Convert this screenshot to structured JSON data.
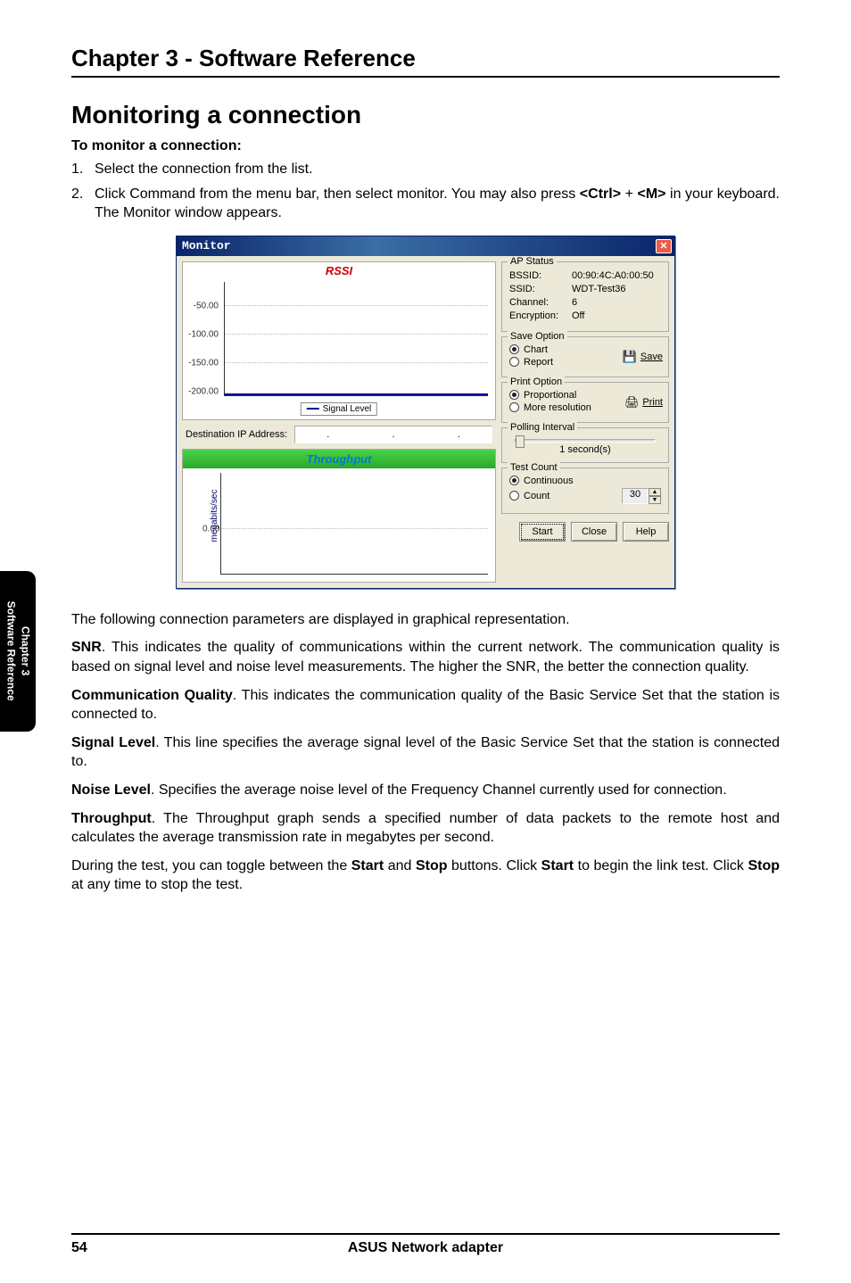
{
  "chapter_title": "Chapter 3 - Software Reference",
  "section_title": "Monitoring a connection",
  "sub_heading": "To monitor a connection:",
  "steps": [
    {
      "num": "1.",
      "text": "Select the connection from the list."
    },
    {
      "num": "2.",
      "text_before": "Click Command from the menu bar, then select monitor. You may also press ",
      "key1": "<Ctrl>",
      "plus": " + ",
      "key2": "<M>",
      "text_after": " in your keyboard. The Monitor window appears."
    }
  ],
  "body": {
    "p1": "The following connection parameters are displayed in graphical representation.",
    "snr_label": "SNR",
    "snr_text": ". This indicates the quality of communications within the current network. The communication quality is based on signal level and noise level measurements. The higher the SNR, the better the connection quality.",
    "cq_label": "Communication Quality",
    "cq_text": ". This indicates the communication quality of the Basic Service Set that the station is connected to.",
    "sl_label": "Signal Level",
    "sl_text": ". This line specifies the average signal level of the Basic Service Set that the station is connected to.",
    "nl_label": "Noise Level",
    "nl_text": ". Specifies the average noise level of the Frequency Channel currently used for connection.",
    "tp_label": "Throughput",
    "tp_text": ". The Throughput graph sends a specified number of data packets to the remote host and calculates the average transmission rate in megabytes per second.",
    "last_before": "During the test, you can toggle between the ",
    "start": "Start",
    "and": " and ",
    "stop": "Stop",
    "mid": " buttons. Click ",
    "start2": "Start",
    "mid2": " to begin the link test. Click ",
    "stop2": "Stop",
    "end": " at any time to stop the test."
  },
  "side_tab": {
    "line1": "Chapter 3",
    "line2": "Software Reference"
  },
  "footer": {
    "page": "54",
    "title": "ASUS Network adapter"
  },
  "dialog": {
    "title": "Monitor",
    "close_glyph": "✕",
    "rssi": {
      "title": "RSSI",
      "yticks": [
        "-50.00",
        "-100.00",
        "-150.00",
        "-200.00"
      ],
      "legend": "Signal Level"
    },
    "dest_label": "Destination IP Address:",
    "throughput": {
      "title": "Throughput",
      "ylabel": "megabits/sec",
      "ytick": "0.00"
    },
    "ap_status": {
      "title": "AP Status",
      "bssid_l": "BSSID:",
      "bssid_v": "00:90:4C:A0:00:50",
      "ssid_l": "SSID:",
      "ssid_v": "WDT-Test36",
      "ch_l": "Channel:",
      "ch_v": "6",
      "enc_l": "Encryption:",
      "enc_v": "Off"
    },
    "save_option": {
      "title": "Save Option",
      "chart": "Chart",
      "report": "Report",
      "save_btn": "Save",
      "icon": "💾"
    },
    "print_option": {
      "title": "Print Option",
      "prop": "Proportional",
      "more": "More resolution",
      "print_btn": "Print",
      "icon": "🖨"
    },
    "polling": {
      "title": "Polling Interval",
      "caption": "1 second(s)"
    },
    "test_count": {
      "title": "Test Count",
      "cont": "Continuous",
      "count": "Count",
      "val": "30"
    },
    "buttons": {
      "start": "Start",
      "close": "Close",
      "help": "Help"
    }
  },
  "chart_data": {
    "type": "line",
    "title": "RSSI",
    "ylabel": "",
    "ylim": [
      -200,
      0
    ],
    "series": [
      {
        "name": "Signal Level",
        "values": []
      }
    ],
    "yticks": [
      -50,
      -100,
      -150,
      -200
    ]
  }
}
